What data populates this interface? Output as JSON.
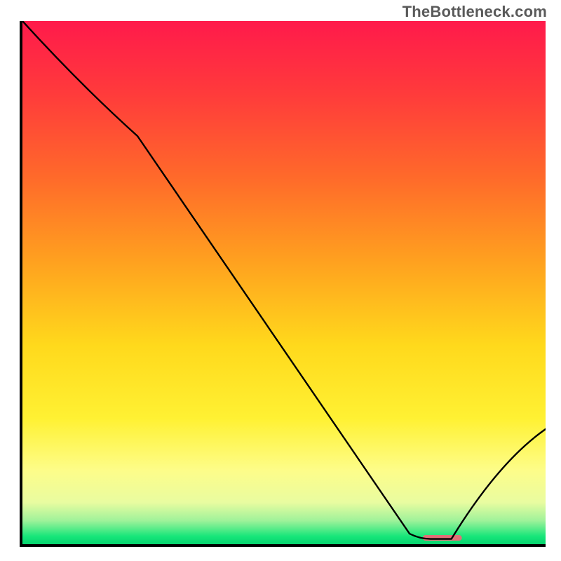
{
  "watermark": "TheBottleneck.com",
  "chart_data": {
    "type": "line",
    "title": "",
    "xlabel": "",
    "ylabel": "",
    "xlim": [
      0,
      100
    ],
    "ylim": [
      0,
      100
    ],
    "grid": false,
    "legend": false,
    "series": [
      {
        "name": "curve",
        "color": "#000000",
        "width": 2.4,
        "x": [
          0,
          22,
          74,
          78,
          82,
          100
        ],
        "y": [
          100,
          78,
          2,
          1,
          1,
          22
        ]
      }
    ],
    "flat_marker": {
      "x_start": 76.5,
      "x_end": 84,
      "y": 1.2,
      "color": "#e17077",
      "thickness": 8
    },
    "background_gradient": {
      "stops": [
        {
          "offset": 0.0,
          "color": "#ff1a4b"
        },
        {
          "offset": 0.14,
          "color": "#ff3b3b"
        },
        {
          "offset": 0.3,
          "color": "#ff6a2a"
        },
        {
          "offset": 0.46,
          "color": "#ffa11f"
        },
        {
          "offset": 0.62,
          "color": "#ffd91c"
        },
        {
          "offset": 0.76,
          "color": "#fff133"
        },
        {
          "offset": 0.86,
          "color": "#fdfd8a"
        },
        {
          "offset": 0.92,
          "color": "#e9fca0"
        },
        {
          "offset": 0.955,
          "color": "#9ff29a"
        },
        {
          "offset": 0.985,
          "color": "#17e67a"
        },
        {
          "offset": 1.0,
          "color": "#06d46f"
        }
      ]
    }
  }
}
